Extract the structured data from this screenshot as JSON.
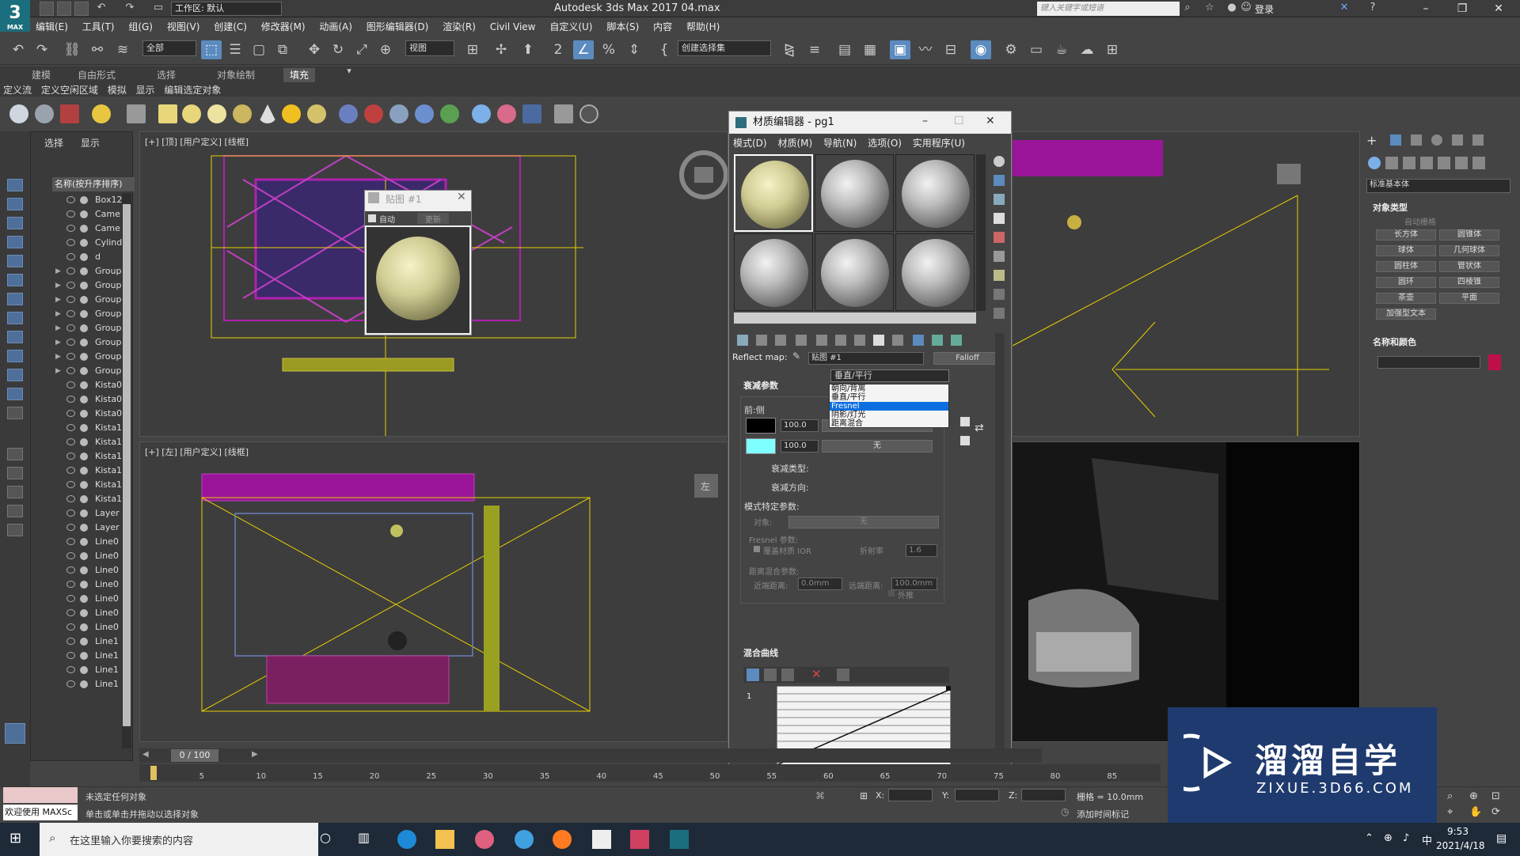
{
  "app": {
    "logo_text": "3",
    "logo_sub": "MAX",
    "workspace": "工作区: 默认",
    "title": "Autodesk 3ds Max 2017      04.max",
    "search_placeholder": "键入关键字或短语",
    "login": "登录"
  },
  "menubar": [
    "编辑(E)",
    "工具(T)",
    "组(G)",
    "视图(V)",
    "创建(C)",
    "修改器(M)",
    "动画(A)",
    "图形编辑器(D)",
    "渲染(R)",
    "Civil View",
    "自定义(U)",
    "脚本(S)",
    "内容",
    "帮助(H)"
  ],
  "toolbar": {
    "selection_filter": "全部",
    "ref_coord": "视图",
    "named_selection": "创建选择集"
  },
  "ribbon_tabs": [
    "建模",
    "自由形式",
    "选择",
    "对象绘制",
    "填充"
  ],
  "ribbon_sub": [
    "定义流",
    "定义空闲区域",
    "模拟",
    "显示",
    "编辑选定对象"
  ],
  "explorer": {
    "tabs": [
      "选择",
      "显示"
    ],
    "header": "名称(按升序排序)",
    "objects": [
      "Box12",
      "Came",
      "Came",
      "Cylind",
      "d",
      "Group",
      "Group",
      "Group",
      "Group",
      "Group",
      "Group",
      "Group",
      "Group",
      "Kista0",
      "Kista0",
      "Kista0",
      "Kista1",
      "Kista1",
      "Kista1",
      "Kista1",
      "Kista1",
      "Kista1",
      "Layer",
      "Layer",
      "Line0",
      "Line0",
      "Line0",
      "Line0",
      "Line0",
      "Line0",
      "Line0",
      "Line1",
      "Line1",
      "Line1",
      "Line1"
    ]
  },
  "viewports": {
    "top_label": "[+] [顶] [用户定义] [线框]",
    "left_label": "[+] [左] [用户定义] [线框]",
    "left_cube": "左"
  },
  "map_popup": {
    "title": "贴图 #1",
    "auto_label": "自动",
    "update_label": "更新"
  },
  "material_editor": {
    "title": "材质编辑器 - pg1",
    "menu": [
      "模式(D)",
      "材质(M)",
      "导航(N)",
      "选项(O)",
      "实用程序(U)"
    ],
    "reflect_map_label": "Reflect map:",
    "map_name": "贴图 #1",
    "map_type": "Falloff",
    "falloff_section": "衰减参数",
    "front_side": "前:侧",
    "value1": "100.0",
    "value2": "100.0",
    "none1": "无",
    "none2": "无",
    "falloff_type_label": "衰减类型:",
    "falloff_type_value": "垂直/平行",
    "falloff_dir_label": "衰减方向:",
    "dropdown_options": [
      "朝向/背离",
      "垂直/平行",
      "Fresnel",
      "阴影/灯光",
      "距离混合"
    ],
    "dropdown_selected": 2,
    "mode_params": "模式特定参数:",
    "object_label": "对象:",
    "object_none": "无",
    "fresnel_params": "Fresnel 参数:",
    "override_ior": "覆盖材质 IOR",
    "ior_label": "折射率",
    "ior_value": "1.6",
    "dist_params": "距离混合参数:",
    "near_label": "近端距离:",
    "near_value": "0.0mm",
    "far_label": "远端距离:",
    "far_value": "100.0mm",
    "extrapolate": "外推",
    "mix_curve_section": "混合曲线",
    "curve_y": "1"
  },
  "command_panel": {
    "category": "标准基本体",
    "object_type_title": "对象类型",
    "autogrid": "自动栅格",
    "buttons": [
      "长方体",
      "圆锥体",
      "球体",
      "几何球体",
      "圆柱体",
      "管状体",
      "圆环",
      "四棱锥",
      "茶壶",
      "平面",
      "加强型文本"
    ],
    "name_color_title": "名称和颜色"
  },
  "timeline": {
    "frame": "0 / 100",
    "ticks": [
      "5",
      "10",
      "15",
      "20",
      "25",
      "30",
      "35",
      "40",
      "45",
      "50",
      "55",
      "60",
      "65",
      "70",
      "75",
      "80",
      "85"
    ]
  },
  "status": {
    "maxscript": "欢迎使用 MAXSc",
    "line1": "未选定任何对象",
    "line2": "单击或单击并拖动以选择对象",
    "x_label": "X:",
    "y_label": "Y:",
    "z_label": "Z:",
    "grid": "栅格 = 10.0mm",
    "add_time_tag": "添加时间标记"
  },
  "taskbar": {
    "search": "在这里输入你要搜索的内容",
    "time": "9:53",
    "date": "2021/4/18",
    "ime": "中"
  },
  "watermark": {
    "brand": "溜溜自学",
    "url": "ZIXUE.3D66.COM"
  },
  "colors": {
    "accent_blue": "#5b8bbf",
    "selection_blue": "#0c6fe0",
    "magenta_geometry": "#b020b0",
    "yellow_lines": "#e8d000",
    "cyan_swatch": "#7fffff",
    "red_swatch": "#c0104a"
  }
}
